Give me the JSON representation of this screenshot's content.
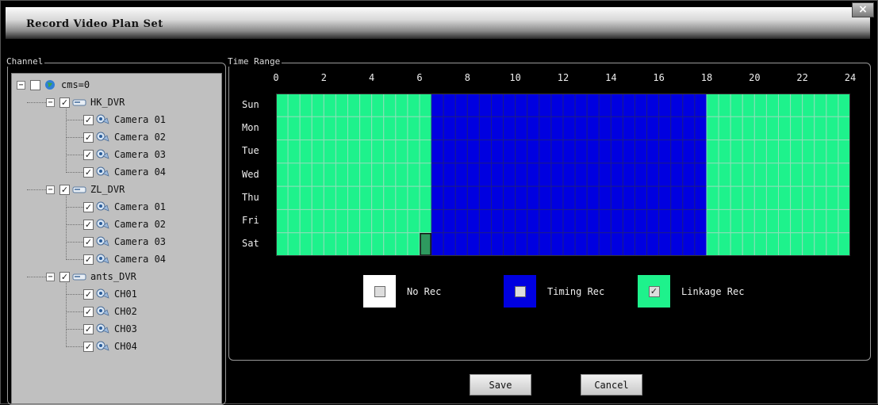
{
  "window": {
    "title": "Record Video Plan Set",
    "close_glyph": "×"
  },
  "channel": {
    "legend": "Channel",
    "root": {
      "label": "cms=0",
      "checked": false,
      "expander": "−"
    },
    "dvrs": [
      {
        "label": "HK_DVR",
        "checked": true,
        "expander": "−",
        "cameras": [
          "Camera 01",
          "Camera 02",
          "Camera 03",
          "Camera 04"
        ]
      },
      {
        "label": "ZL_DVR",
        "checked": true,
        "expander": "−",
        "cameras": [
          "Camera 01",
          "Camera 02",
          "Camera 03",
          "Camera 04"
        ]
      },
      {
        "label": "ants_DVR",
        "checked": true,
        "expander": "−",
        "cameras": [
          "CH01",
          "CH02",
          "CH03",
          "CH04"
        ]
      }
    ]
  },
  "time_range": {
    "legend": "Time Range",
    "hour_ticks": [
      "0",
      "2",
      "4",
      "6",
      "8",
      "10",
      "12",
      "14",
      "16",
      "18",
      "20",
      "22",
      "24"
    ],
    "days": [
      "Sun",
      "Mon",
      "Tue",
      "Wed",
      "Thu",
      "Fri",
      "Sat"
    ],
    "slots_per_hour": 2,
    "timing_rec_start_hour": 6.5,
    "timing_rec_end_hour": 18,
    "selected_slot": {
      "day": "Sat",
      "slot_index": 12
    }
  },
  "legend_items": [
    {
      "label": "No Rec",
      "mark": "",
      "color": "#ffffff"
    },
    {
      "label": "Timing Rec",
      "mark": "",
      "color": "#0000e0"
    },
    {
      "label": "Linkage Rec",
      "mark": "✓",
      "color": "#1ef28c"
    }
  ],
  "buttons": {
    "save": "Save",
    "cancel": "Cancel"
  },
  "colors": {
    "no_rec": "#ffffff",
    "timing_rec": "#0000e0",
    "linkage_rec": "#1ef28c",
    "grid_line": "#1b1b8a",
    "grid_line_linkage": "#8ddfb8"
  },
  "check_glyph": "✓"
}
